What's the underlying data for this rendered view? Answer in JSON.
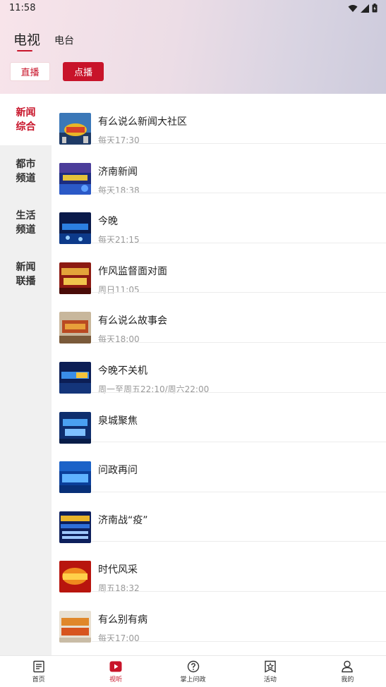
{
  "status_bar": {
    "time": "11:58",
    "icons": [
      "wifi-icon",
      "signal-icon",
      "battery-icon"
    ]
  },
  "top_tabs": [
    {
      "label": "电视",
      "active": true
    },
    {
      "label": "电台",
      "active": false
    }
  ],
  "mode_buttons": {
    "live": "直播",
    "vod": "点播"
  },
  "sidebar": {
    "items": [
      {
        "label": "新闻综合",
        "active": true
      },
      {
        "label": "都市频道",
        "active": false
      },
      {
        "label": "生活频道",
        "active": false
      },
      {
        "label": "新闻联播",
        "active": false
      }
    ]
  },
  "programs": [
    {
      "title": "有么说么新闻大社区",
      "time": "每天17:30",
      "thumb": "thumb-1"
    },
    {
      "title": "济南新闻",
      "time": "每天18:38",
      "thumb": "thumb-2"
    },
    {
      "title": "今晚",
      "time": "每天21:15",
      "thumb": "thumb-3"
    },
    {
      "title": "作风监督面对面",
      "time": "周日11:05",
      "thumb": "thumb-4"
    },
    {
      "title": "有么说么故事会",
      "time": "每天18:00",
      "thumb": "thumb-5"
    },
    {
      "title": "今晚不关机",
      "time": "周一至周五22:10/周六22:00",
      "thumb": "thumb-6"
    },
    {
      "title": "泉城聚焦",
      "time": "",
      "thumb": "thumb-7"
    },
    {
      "title": "问政再问",
      "time": "",
      "thumb": "thumb-8"
    },
    {
      "title": "济南战“疫”",
      "time": "",
      "thumb": "thumb-9"
    },
    {
      "title": "时代风采",
      "time": "周五18:32",
      "thumb": "thumb-10"
    },
    {
      "title": "有么别有病",
      "time": "每天17:00",
      "thumb": "thumb-11"
    }
  ],
  "bottom_nav": [
    {
      "label": "首页",
      "icon": "news-icon",
      "active": false
    },
    {
      "label": "视听",
      "icon": "play-icon",
      "active": true
    },
    {
      "label": "掌上问政",
      "icon": "question-icon",
      "active": false
    },
    {
      "label": "活动",
      "icon": "star-icon",
      "active": false
    },
    {
      "label": "我的",
      "icon": "user-icon",
      "active": false
    }
  ],
  "colors": {
    "accent": "#c8142a",
    "sidebar_bg": "#f0f0f0",
    "muted_text": "#999999"
  }
}
